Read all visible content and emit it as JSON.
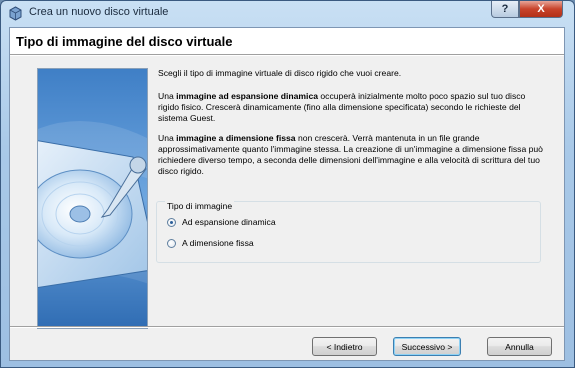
{
  "window": {
    "title": "Crea un nuovo disco virtuale",
    "help_label": "?",
    "close_label": "X"
  },
  "header": {
    "title": "Tipo di immagine del disco virtuale"
  },
  "content": {
    "intro": "Scegli il tipo di immagine virtuale di disco rigido che vuoi creare.",
    "dynamic_prefix": "Una ",
    "dynamic_bold": "immagine ad espansione dinamica",
    "dynamic_rest": " occuperà inizialmente molto poco spazio sul tuo disco rigido fisico. Crescerà dinamicamente (fino alla dimensione specificata) secondo le richieste del sistema Guest.",
    "fixed_prefix": "Una ",
    "fixed_bold": "immagine a dimensione fissa",
    "fixed_rest": " non crescerà. Verrà mantenuta in un file grande approssimativamente quanto l'immagine stessa. La creazione di un'immagine a dimensione fissa può richiedere diverso tempo, a seconda delle dimensioni dell'immagine e alla velocità di scrittura del tuo disco rigido."
  },
  "image_type": {
    "legend": "Tipo di immagine",
    "options": [
      {
        "label": "Ad espansione dinamica",
        "selected": true
      },
      {
        "label": "A dimensione fissa",
        "selected": false
      }
    ]
  },
  "buttons": {
    "back": "< Indietro",
    "next": "Successivo >",
    "cancel": "Annulla"
  },
  "icons": {
    "app": "virtualbox-icon",
    "illustration": "hard-disk-illustration"
  },
  "colors": {
    "titlebar": "#a9c9e8",
    "close": "#c8432b",
    "default_button_border": "#3c7fb1"
  }
}
